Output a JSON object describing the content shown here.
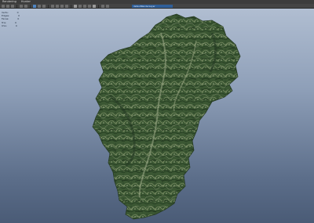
{
  "menu": {
    "items": [
      "Rendering",
      "Hunter"
    ]
  },
  "toolbar": {
    "camera_field": "defaultRenderLayer"
  },
  "hud": {
    "rows": [
      {
        "label": "Verts:",
        "value": "0"
      },
      {
        "label": "Edges:",
        "value": "0"
      },
      {
        "label": "Faces:",
        "value": "0"
      },
      {
        "label": "Tris:",
        "value": "0"
      },
      {
        "label": "UVs:",
        "value": "0"
      }
    ]
  },
  "colors": {
    "terrain_dark": "#2f4a2b",
    "terrain_mid": "#4a6a3e",
    "terrain_light": "#8a9a72",
    "sky_top": "#b4c1d4",
    "sky_bottom": "#4a5b76"
  }
}
